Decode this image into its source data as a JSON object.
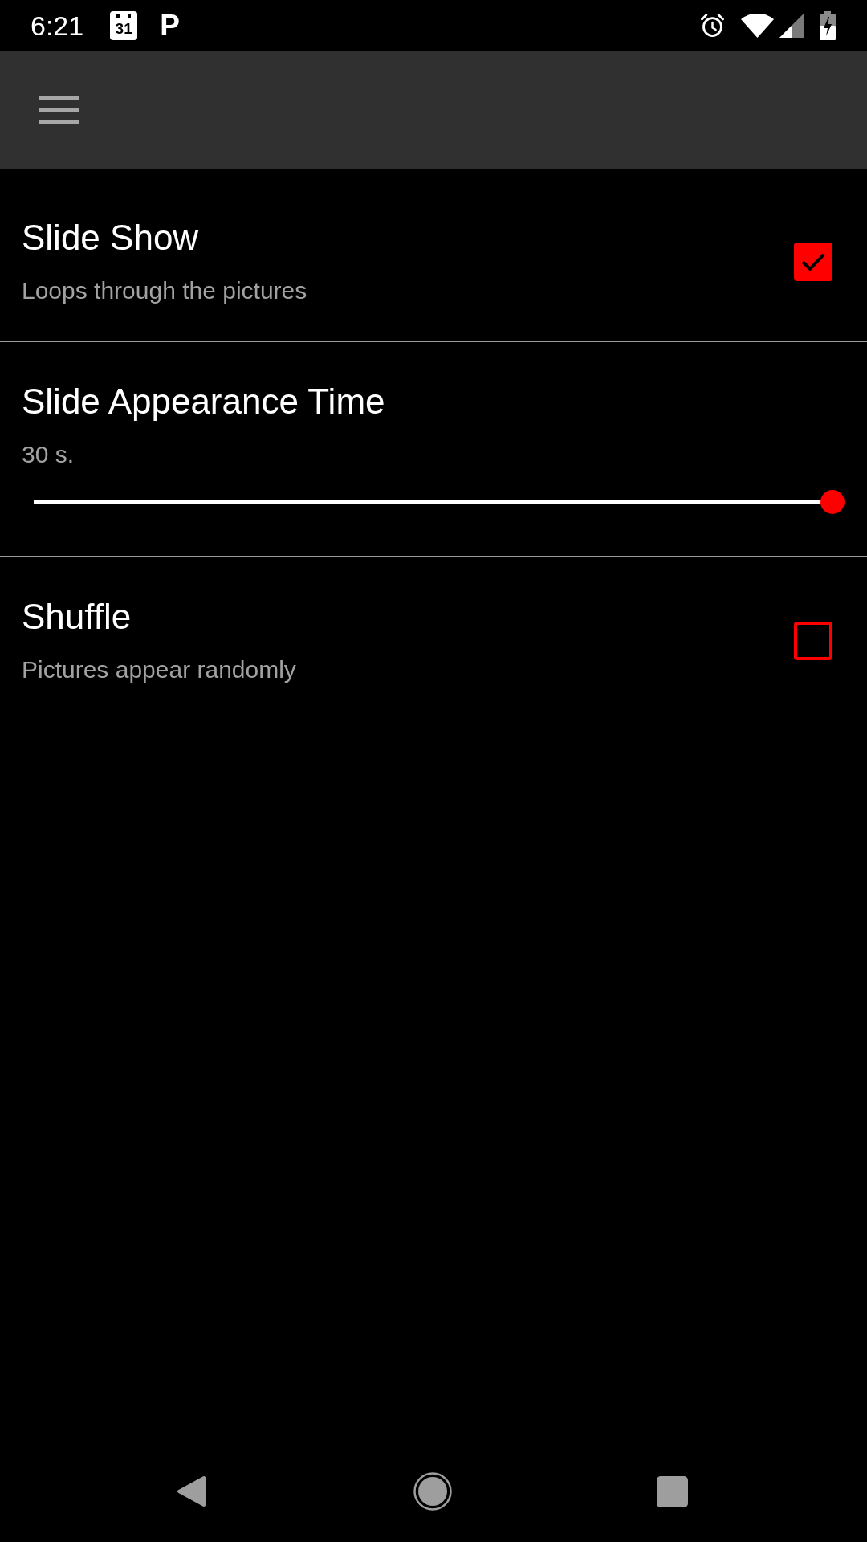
{
  "status_bar": {
    "time": "6:21",
    "calendar_day": "31",
    "notification_letter": "P"
  },
  "settings": [
    {
      "kind": "checkbox",
      "title": "Slide Show",
      "summary": "Loops through the pictures",
      "checked": true
    },
    {
      "kind": "slider",
      "title": "Slide Appearance Time",
      "summary": "30 s.",
      "level": 1.0
    },
    {
      "kind": "checkbox",
      "title": "Shuffle",
      "summary": "Pictures appear randomly",
      "checked": false
    }
  ]
}
